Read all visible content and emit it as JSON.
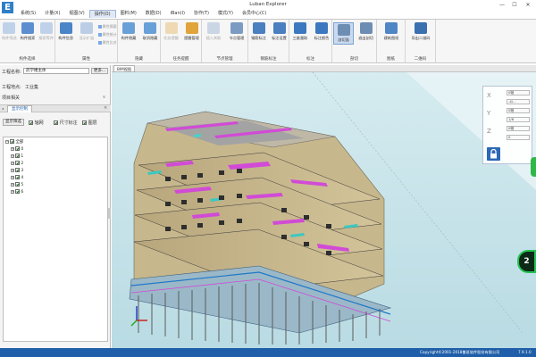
{
  "window": {
    "title": "Luban Explorer",
    "logo_text": "E",
    "min_glyph": "—",
    "max_glyph": "☐",
    "close_glyph": "✕"
  },
  "menu": [
    "系统(S)",
    "计量(X)",
    "视图(V)",
    "操作(O)",
    "图料(M)",
    "数据(D)",
    "iBan(I)",
    "协作(T)",
    "模式(Y)",
    "会员中心(C)"
  ],
  "menu_active_index": 3,
  "ribbon": {
    "groups": [
      {
        "label": "构件选择",
        "buttons": [
          {
            "label": "构件筛选",
            "disabled": true
          },
          {
            "label": "构件搜索",
            "disabled": false
          },
          {
            "label": "搜索等件",
            "disabled": true
          }
        ]
      },
      {
        "label": "属性",
        "buttons": [
          {
            "label": "构件信息",
            "disabled": false
          },
          {
            "label": "显示扩展",
            "disabled": true
          }
        ],
        "small": [
          "属性摘要",
          "属性统计",
          "属性比对"
        ]
      },
      {
        "label": "隐藏",
        "buttons": [
          {
            "label": "构件隐藏",
            "disabled": false
          },
          {
            "label": "取消隐藏",
            "disabled": false
          }
        ]
      },
      {
        "label": "任务提醒",
        "buttons": [
          {
            "label": "任务提醒",
            "disabled": true
          },
          {
            "label": "提醒管理",
            "disabled": false
          }
        ]
      },
      {
        "label": "节点管理",
        "buttons": [
          {
            "label": "插入关联",
            "disabled": true
          },
          {
            "label": "节点管理",
            "disabled": false
          }
        ]
      },
      {
        "label": "钢筋标注",
        "buttons": [
          {
            "label": "钢筋标注",
            "disabled": false
          },
          {
            "label": "标注设置",
            "disabled": false
          }
        ]
      },
      {
        "label": "标注",
        "buttons": [
          {
            "label": "三维量取",
            "disabled": false
          },
          {
            "label": "标注颜色",
            "disabled": false
          }
        ]
      },
      {
        "label": "剖切",
        "buttons": [
          {
            "label": "剖切面",
            "disabled": false,
            "pressed": true
          },
          {
            "label": "退出剖切",
            "disabled": false
          }
        ]
      },
      {
        "label": "图纸",
        "buttons": [
          {
            "label": "建筑图纸",
            "disabled": false
          }
        ]
      },
      {
        "label": "二维码",
        "buttons": [
          {
            "label": "导出二维码",
            "disabled": false
          }
        ]
      }
    ]
  },
  "left_panel": {
    "project_label": "工程名称:",
    "project_value": "药学楼主体",
    "more_button": "更多...",
    "location_label": "工程地点:",
    "location_value": "工业集",
    "related_label": "项目相关",
    "panel_tab": "显示控制",
    "filter_button": "显示筛选",
    "checks": [
      {
        "label": "轴网",
        "on": true
      },
      {
        "label": "尺寸标注",
        "on": true
      },
      {
        "label": "图层",
        "on": true
      }
    ],
    "tree_root": "全部",
    "tree_floors": [
      "0",
      "1",
      "2",
      "3",
      "4",
      "5",
      "6"
    ]
  },
  "viewport": {
    "tab_label": "BIM视图"
  },
  "nav_tool": {
    "rows": [
      {
        "icon": "X",
        "value": "0轴"
      },
      {
        "icon": "",
        "value": "-4/..."
      },
      {
        "icon": "Y",
        "value": "0轴"
      },
      {
        "icon": "",
        "value": "1/6"
      },
      {
        "icon": "Z",
        "value": "0轴"
      },
      {
        "icon": "",
        "value": "0"
      }
    ],
    "lock_icon": "🔒"
  },
  "float_badge": "2",
  "status": {
    "left": "",
    "middle": "Copyright©2001-2018鲁班软件股份有限公司",
    "right": "7.9.1.0"
  },
  "colors": {
    "ribbon_bg": "#f6f6f6",
    "status_bar": "#1f5ea8",
    "accent": "#2f7fc8",
    "viewport_sky": "#cfe6ec"
  }
}
